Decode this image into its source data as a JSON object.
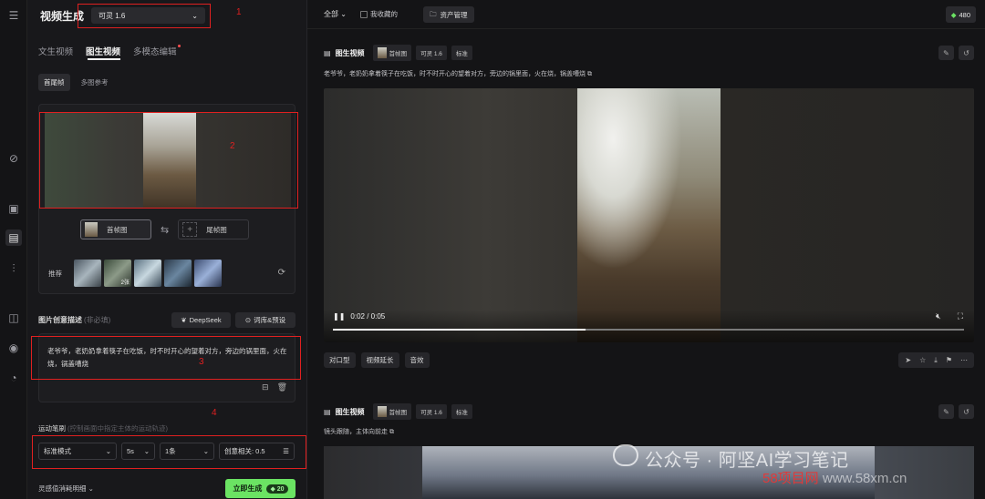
{
  "panel": {
    "title": "视频生成",
    "model": "可灵 1.6",
    "tabs": [
      "文生视频",
      "图生视频",
      "多模态编辑"
    ],
    "subtabs": [
      "首尾帧",
      "多图参考"
    ],
    "first_frame_label": "首帧图",
    "last_frame_label": "尾帧图",
    "recommend_label": "推荐",
    "recommend_count": "2张",
    "desc_label": "图片创意描述",
    "desc_optional": "(非必填)",
    "deepseek_label": "DeepSeek",
    "library_label": "词库&预设",
    "prompt": "老爷爷，老奶奶拿着筷子在吃饭，时不时开心的望着对方，旁边的锅里面，火在烧，锅盖嘈烧",
    "motion_label": "运动笔刷",
    "motion_hint": "(控制画面中指定主体的运动轨迹)",
    "mode": "标准模式",
    "duration": "5s",
    "count": "1条",
    "creativity": "创意相关: 0.5",
    "points_info": "灵感值消耗明细",
    "generate_label": "立即生成",
    "generate_cost": "20"
  },
  "annotations": [
    "1",
    "2",
    "3",
    "4"
  ],
  "topbar": {
    "filter": "全部",
    "favorites": "我收藏的",
    "assets": "资产管理",
    "points": "480"
  },
  "card1": {
    "title": "图生视频",
    "tags": [
      "首帧图",
      "可灵 1.6",
      "标准"
    ],
    "desc": "老爷爷，老奶奶拿着筷子在吃饭，时不时开心的望着对方，旁边的锅里面，火在烧，锅盖嘈烧",
    "time": "0:02 / 0:05",
    "progress": 0.4,
    "actions": [
      "对口型",
      "视频延长",
      "音效"
    ]
  },
  "card2": {
    "title": "图生视频",
    "tags": [
      "首帧图",
      "可灵 1.6",
      "标准"
    ],
    "desc": "镜头跟随，主体向前走"
  },
  "watermark": {
    "main": "公众号 · 阿坚AI学习笔记",
    "site_red": "58项目网",
    "site": " www.58xm.cn"
  }
}
